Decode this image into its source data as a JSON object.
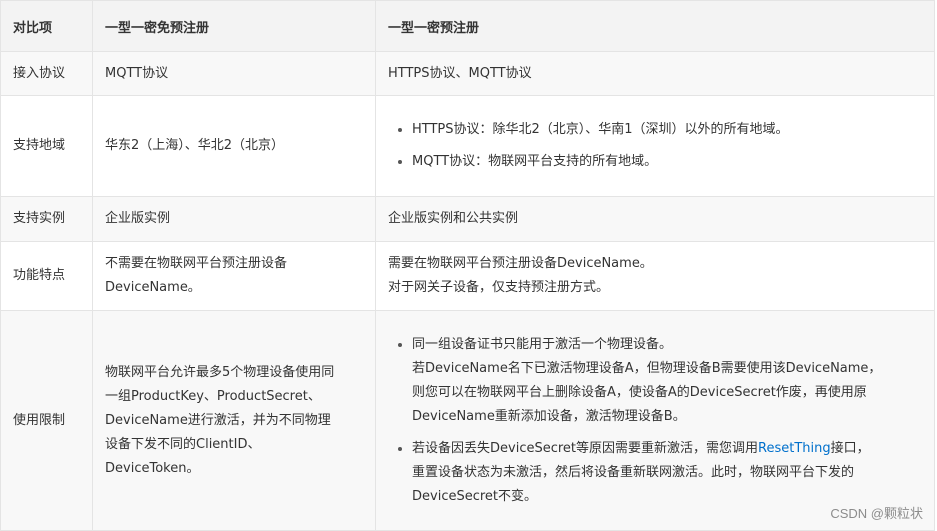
{
  "headers": [
    "对比项",
    "一型一密免预注册",
    "一型一密预注册"
  ],
  "rows": {
    "access": {
      "label": "接入协议",
      "col1": "MQTT协议",
      "col2": "HTTPS协议、MQTT协议"
    },
    "region": {
      "label": "支持地域",
      "col1": "华东2（上海）、华北2（北京）",
      "col2_items": [
        "HTTPS协议：除华北2（北京）、华南1（深圳）以外的所有地域。",
        "MQTT协议：物联网平台支持的所有地域。"
      ]
    },
    "instance": {
      "label": "支持实例",
      "col1": "企业版实例",
      "col2": "企业版实例和公共实例"
    },
    "feature": {
      "label": "功能特点",
      "col1_lines": [
        "不需要在物联网平台预注册设备",
        "DeviceName。"
      ],
      "col2_lines": [
        "需要在物联网平台预注册设备DeviceName。",
        "对于网关子设备，仅支持预注册方式。"
      ]
    },
    "limit": {
      "label": "使用限制",
      "col1_lines": [
        "物联网平台允许最多5个物理设备使用同",
        "一组ProductKey、ProductSecret、",
        "DeviceName进行激活，并为不同物理",
        "设备下发不同的ClientID、",
        "DeviceToken。"
      ],
      "item1_lines": [
        "同一组设备证书只能用于激活一个物理设备。",
        "若DeviceName名下已激活物理设备A，但物理设备B需要使用该DeviceName，",
        "则您可以在物联网平台上删除设备A，使设备A的DeviceSecret作废，再使用原",
        "DeviceName重新添加设备，激活物理设备B。"
      ],
      "item2_pre": "若设备因丢失DeviceSecret等原因需要重新激活，需您调用",
      "item2_link": "ResetThing",
      "item2_post": "接口，",
      "item2_lines": [
        "重置设备状态为未激活，然后将设备重新联网激活。此时，物联网平台下发的",
        "DeviceSecret不变。"
      ]
    }
  },
  "watermark": "CSDN @颗粒状"
}
